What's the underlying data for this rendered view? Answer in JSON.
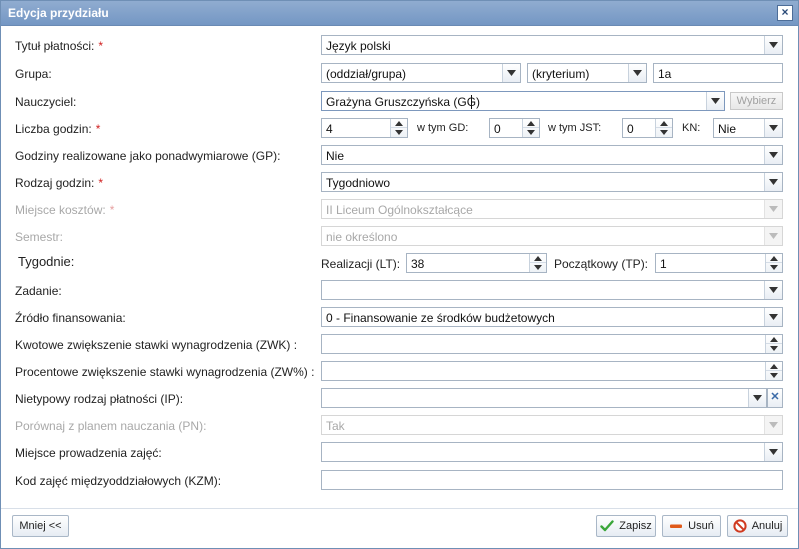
{
  "window": {
    "title": "Edycja przydziału"
  },
  "required_mark": "*",
  "fields": {
    "tytul": {
      "label": "Tytuł płatności:",
      "value": "Język polski"
    },
    "grupa": {
      "label": "Grupa:",
      "oddzial": "(oddział/grupa)",
      "kryterium": "(kryterium)",
      "text": "1a"
    },
    "nauczyciel": {
      "label": "Nauczyciel:",
      "value": "Grażyna Gruszczyńska (GG)",
      "button": "Wybierz"
    },
    "liczba": {
      "label": "Liczba godzin:",
      "value": "4",
      "gd_label": "w tym GD:",
      "gd_value": "0",
      "jst_label": "w tym JST:",
      "jst_value": "0",
      "kn_label": "KN:",
      "kn_value": "Nie"
    },
    "gp": {
      "label": "Godziny realizowane jako ponadwymiarowe (GP):",
      "value": "Nie"
    },
    "rodzaj": {
      "label": "Rodzaj godzin:",
      "value": "Tygodniowo"
    },
    "miejsce_kosztow": {
      "label": "Miejsce kosztów:",
      "value": "II Liceum Ogólnokształcące"
    },
    "semestr": {
      "label": "Semestr:",
      "value": "nie określono"
    },
    "tygodnie": {
      "label": "Tygodnie:",
      "lt_label": "Realizacji (LT):",
      "lt_value": "38",
      "tp_label": "Początkowy (TP):",
      "tp_value": "1"
    },
    "zadanie": {
      "label": "Zadanie:",
      "value": ""
    },
    "zrodlo": {
      "label": "Źródło finansowania:",
      "value": "0 - Finansowanie ze środków budżetowych"
    },
    "zwk": {
      "label": "Kwotowe zwiększenie stawki wynagrodzenia (ZWK) :",
      "value": ""
    },
    "zwp": {
      "label": "Procentowe zwiększenie stawki wynagrodzenia (ZW%) :",
      "value": ""
    },
    "ip": {
      "label": "Nietypowy rodzaj płatności (IP):",
      "value": ""
    },
    "pn": {
      "label": "Porównaj z planem nauczania (PN):",
      "value": "Tak"
    },
    "miejsce_zajec": {
      "label": "Miejsce prowadzenia zajęć:",
      "value": ""
    },
    "kzm": {
      "label": "Kod zajęć międzyoddziałowych (KZM):",
      "value": ""
    }
  },
  "footer": {
    "less_label": "Mniej <<",
    "save_label": "Zapisz",
    "delete_label": "Usuń",
    "cancel_label": "Anuluj"
  },
  "icons": {
    "close": "close-icon",
    "dropdown": "chevron-down-icon",
    "spin_up": "spin-up-icon",
    "spin_down": "spin-down-icon",
    "clear": "clear-icon",
    "save": "checkmark-icon",
    "delete": "minus-icon",
    "cancel": "no-entry-icon"
  },
  "colors": {
    "titlebar": "#7f9fca",
    "required": "#d02020",
    "disabled_text": "#a8a8a8",
    "save_icon": "#3aa63a",
    "delete_icon": "#e05a1a",
    "cancel_icon": "#d03a20"
  }
}
